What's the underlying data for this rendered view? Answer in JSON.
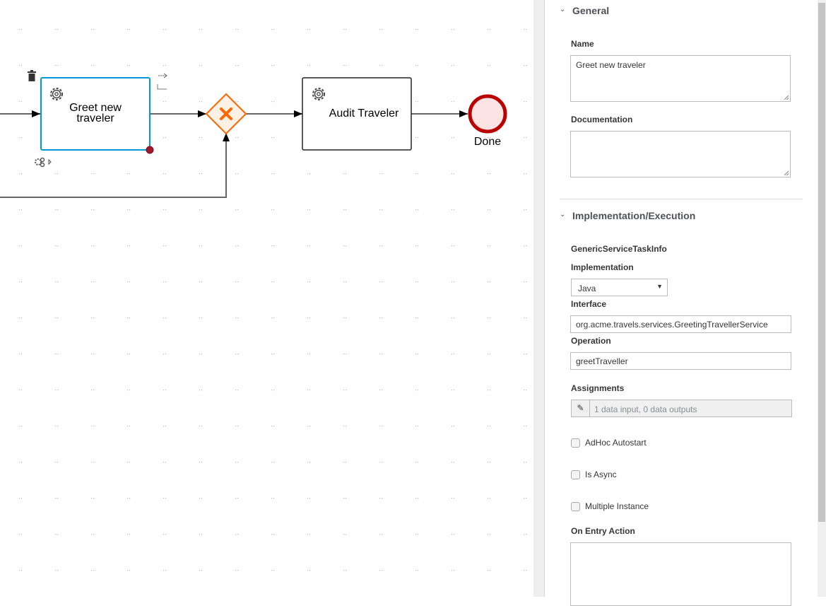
{
  "diagram": {
    "nodes": {
      "greet_task": "Greet new\ntraveler",
      "greet_task_line1": "Greet new",
      "greet_task_line2": "traveler",
      "audit_task": "Audit Traveler",
      "end_event": "Done"
    },
    "colors": {
      "selected_border": "#0099d3",
      "gateway_stroke": "#ff6600",
      "gateway_fill": "#fdf1e5",
      "end_stroke": "#bb0000",
      "end_fill": "#fde3e3"
    }
  },
  "panel": {
    "general": {
      "title": "General",
      "name_label": "Name",
      "name_value": "Greet new traveler",
      "documentation_label": "Documentation",
      "documentation_value": ""
    },
    "implementation": {
      "title": "Implementation/Execution",
      "info_label": "GenericServiceTaskInfo",
      "implementation_label": "Implementation",
      "implementation_value": "Java",
      "interface_label": "Interface",
      "interface_value": "org.acme.travels.services.GreetingTravellerService",
      "operation_label": "Operation",
      "operation_value": "greetTraveller",
      "assignments_label": "Assignments",
      "assignments_value": "1 data input, 0 data outputs",
      "adhoc_autostart": {
        "label": "AdHoc Autostart",
        "checked": false
      },
      "is_async": {
        "label": "Is Async",
        "checked": false
      },
      "multiple_instance": {
        "label": "Multiple Instance",
        "checked": false
      },
      "on_entry_label": "On Entry Action",
      "on_entry_value": ""
    }
  }
}
